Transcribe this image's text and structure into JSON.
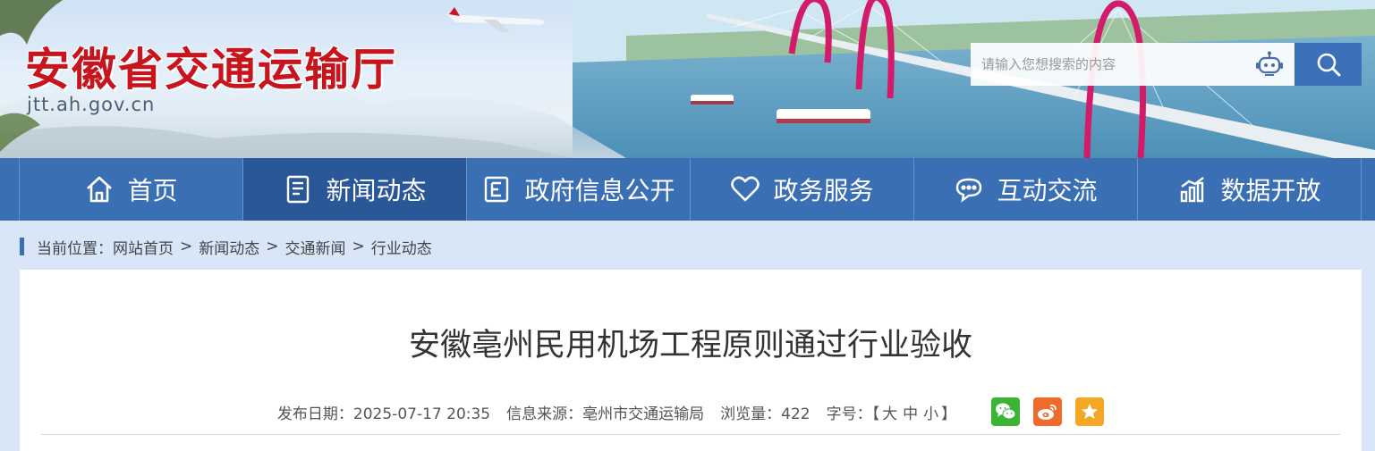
{
  "header": {
    "title": "安徽省交通运输厅",
    "domain": "jtt.ah.gov.cn",
    "search": {
      "placeholder": "请输入您想搜索的内容"
    },
    "accent": "#c8141c"
  },
  "nav": {
    "color": "#3b6fb4",
    "active_color": "#2a5797",
    "items": [
      {
        "label": "首页",
        "icon": "home-icon"
      },
      {
        "label": "新闻动态",
        "icon": "news-icon"
      },
      {
        "label": "政府信息公开",
        "icon": "document-icon"
      },
      {
        "label": "政务服务",
        "icon": "heart-icon"
      },
      {
        "label": "互动交流",
        "icon": "chat-icon"
      },
      {
        "label": "数据开放",
        "icon": "chart-icon"
      }
    ],
    "active_index": 1
  },
  "breadcrumb": {
    "prefix": "当前位置：",
    "items": [
      "网站首页",
      "新闻动态",
      "交通新闻",
      "行业动态"
    ],
    "separator": ">"
  },
  "article": {
    "title": "安徽亳州民用机场工程原则通过行业验收",
    "date_label": "发布日期：",
    "date": "2025-07-17 20:35",
    "source_label": "信息来源：",
    "source": "亳州市交通运输局",
    "views_label": "浏览量：",
    "views": "422",
    "font_label": "字号：",
    "font_open": "【",
    "font_sizes": [
      "大",
      "中",
      "小"
    ],
    "font_close": "】"
  },
  "share": [
    {
      "icon": "wechat-icon",
      "color": "#3bb335"
    },
    {
      "icon": "weibo-icon",
      "color": "#f06a2b"
    },
    {
      "icon": "favorite-star-icon",
      "color": "#f5a623"
    }
  ]
}
